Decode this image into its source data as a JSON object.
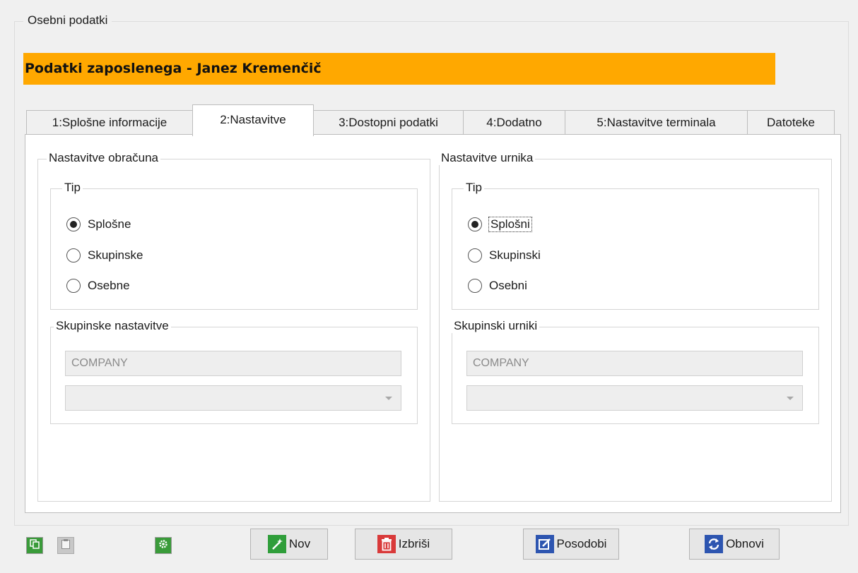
{
  "window": {
    "group_title": "Osebni podatki"
  },
  "header": {
    "title": "Podatki zaposlenega - Janez Kremenčič"
  },
  "tabs": [
    {
      "label": "1:Splošne informacije"
    },
    {
      "label": "2:Nastavitve",
      "active": true
    },
    {
      "label": "3:Dostopni podatki"
    },
    {
      "label": "4:Dodatno"
    },
    {
      "label": "5:Nastavitve terminala"
    },
    {
      "label": "Datoteke"
    }
  ],
  "left_panel": {
    "title": "Nastavitve obračuna",
    "type_group": {
      "title": "Tip",
      "options": [
        "Splošne",
        "Skupinske",
        "Osebne"
      ],
      "selected": "Splošne"
    },
    "group_settings": {
      "title": "Skupinske nastavitve",
      "text_value": "COMPANY",
      "combo_value": ""
    }
  },
  "right_panel": {
    "title": "Nastavitve urnika",
    "type_group": {
      "title": "Tip",
      "options": [
        "Splošni",
        "Skupinski",
        "Osebni"
      ],
      "selected": "Splošni"
    },
    "group_schedules": {
      "title": "Skupinski urniki",
      "text_value": "COMPANY",
      "combo_value": ""
    }
  },
  "toolbar": {
    "icons": [
      "copy-icon",
      "paste-icon",
      "settings-icon"
    ],
    "buttons": [
      {
        "label": "Nov",
        "icon": "magic-wand-icon"
      },
      {
        "label": "Izbriši",
        "icon": "trash-icon"
      },
      {
        "label": "Posodobi",
        "icon": "edit-icon"
      },
      {
        "label": "Obnovi",
        "icon": "refresh-icon"
      }
    ]
  },
  "colors": {
    "header_bar": "#ffa800",
    "tab_active_bg": "#ffffff",
    "window_bg": "#f0f0f0"
  }
}
